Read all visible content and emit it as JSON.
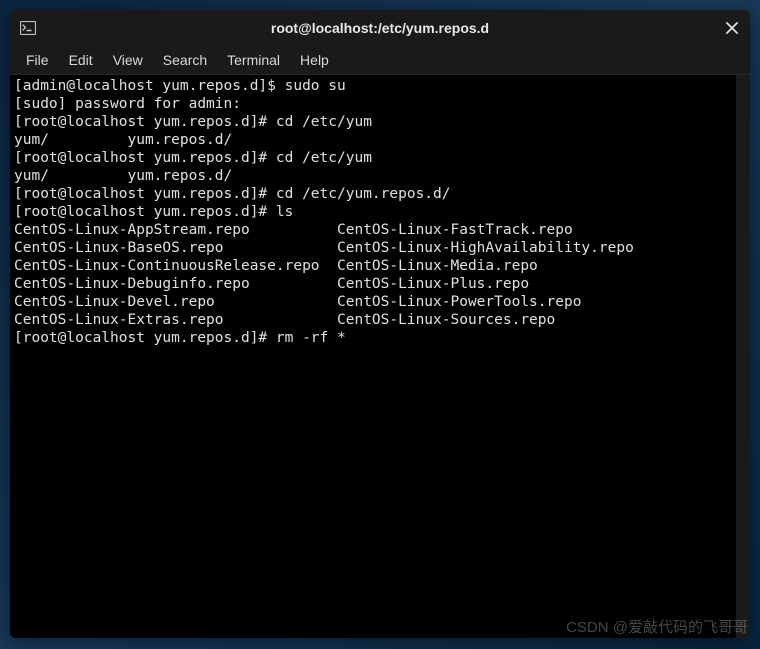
{
  "window": {
    "title": "root@localhost:/etc/yum.repos.d"
  },
  "menubar": {
    "items": [
      "File",
      "Edit",
      "View",
      "Search",
      "Terminal",
      "Help"
    ]
  },
  "terminal": {
    "lines": [
      "[admin@localhost yum.repos.d]$ sudo su",
      "[sudo] password for admin:",
      "[root@localhost yum.repos.d]# cd /etc/yum",
      "yum/         yum.repos.d/",
      "[root@localhost yum.repos.d]# cd /etc/yum",
      "yum/         yum.repos.d/",
      "[root@localhost yum.repos.d]# cd /etc/yum.repos.d/",
      "[root@localhost yum.repos.d]# ls",
      "CentOS-Linux-AppStream.repo          CentOS-Linux-FastTrack.repo",
      "CentOS-Linux-BaseOS.repo             CentOS-Linux-HighAvailability.repo",
      "CentOS-Linux-ContinuousRelease.repo  CentOS-Linux-Media.repo",
      "CentOS-Linux-Debuginfo.repo          CentOS-Linux-Plus.repo",
      "CentOS-Linux-Devel.repo              CentOS-Linux-PowerTools.repo",
      "CentOS-Linux-Extras.repo             CentOS-Linux-Sources.repo",
      "[root@localhost yum.repos.d]# rm -rf *"
    ]
  },
  "watermark": "CSDN @爱敲代码的飞哥哥"
}
